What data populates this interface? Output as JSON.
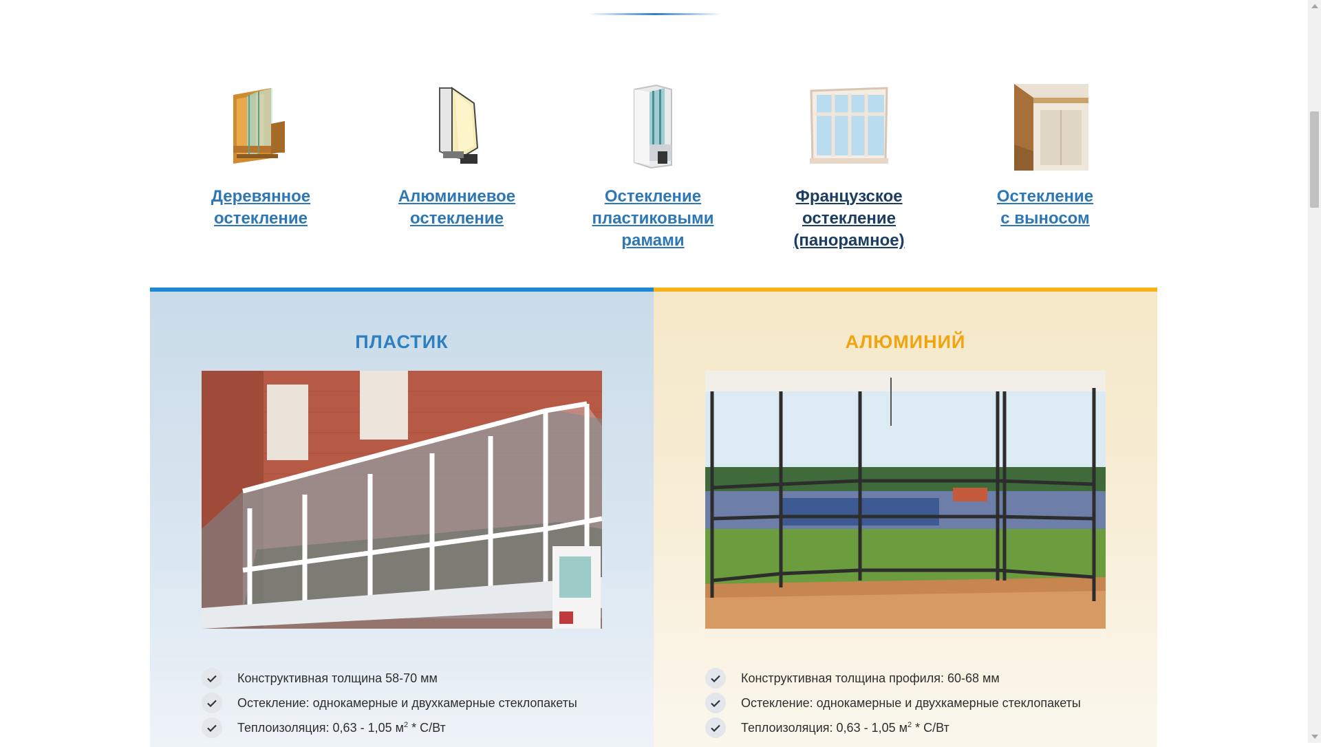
{
  "types": [
    {
      "label": "Деревянное\nостекление",
      "icon": "wooden-window-profile-icon"
    },
    {
      "label": "Алюминиевое\nостекление",
      "icon": "aluminum-window-profile-icon"
    },
    {
      "label": "Остекление\nпластиковыми\nрамами",
      "icon": "plastic-window-profile-icon"
    },
    {
      "label": "Французское\nостекление\n(панорамное)",
      "icon": "french-panoramic-window-icon"
    },
    {
      "label": "Остекление\nс выносом",
      "icon": "extended-balcony-icon"
    }
  ],
  "cards": {
    "plastic": {
      "title": "ПЛАСТИК",
      "accent": "#1f87d6",
      "features": [
        "Конструктивная толщина 58-70 мм",
        "Остекление: однокамерные и двухкамерные стеклопакеты",
        "Теплоизоляция: 0,63 - 1,05 м",
        "* С/Вт"
      ],
      "sup": "2"
    },
    "aluminum": {
      "title": "АЛЮМИНИЙ",
      "accent": "#f5b21a",
      "features": [
        "Конструктивная толщина профиля: 60-68 мм",
        "Остекление: однокамерные и двухкамерные стеклопакеты",
        "Теплоизоляция: 0,63 - 1,05 м",
        "* С/Вт"
      ],
      "sup": "2"
    }
  }
}
